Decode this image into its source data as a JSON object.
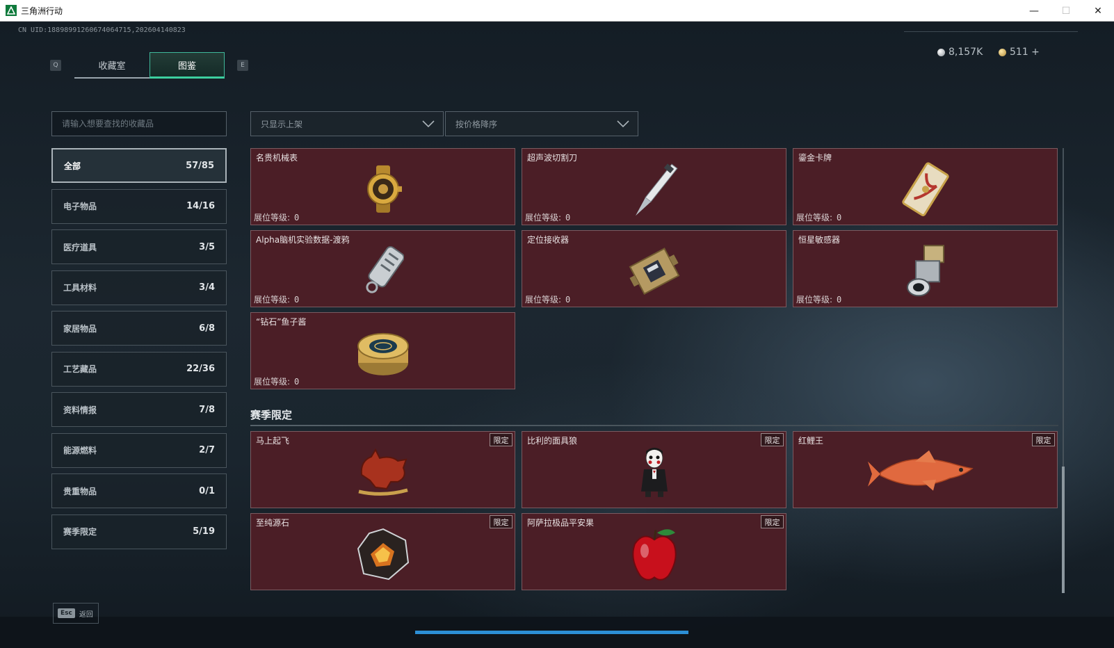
{
  "window": {
    "title": "三角洲行动",
    "minimize_glyph": "—",
    "maximize_glyph": "☐",
    "close_glyph": "✕"
  },
  "header": {
    "uid": "CN UID:18898991260674064715,202604140823",
    "key_prev": "Q",
    "key_next": "E",
    "tabs": [
      {
        "label": "收藏室",
        "active": false
      },
      {
        "label": "图鉴",
        "active": true
      }
    ],
    "currency": [
      {
        "type": "silver-coin-icon",
        "value": "8,157K"
      },
      {
        "type": "gold-coin-icon",
        "value": "511 +"
      }
    ]
  },
  "sidebar": {
    "search_placeholder": "请输入想要查找的收藏品",
    "categories": [
      {
        "label": "全部",
        "count": "57/85",
        "active": true
      },
      {
        "label": "电子物品",
        "count": "14/16"
      },
      {
        "label": "医疗道具",
        "count": "3/5"
      },
      {
        "label": "工具材料",
        "count": "3/4"
      },
      {
        "label": "家居物品",
        "count": "6/8"
      },
      {
        "label": "工艺藏品",
        "count": "22/36"
      },
      {
        "label": "资料情报",
        "count": "7/8"
      },
      {
        "label": "能源燃料",
        "count": "2/7"
      },
      {
        "label": "贵重物品",
        "count": "0/1"
      },
      {
        "label": "赛季限定",
        "count": "5/19"
      }
    ]
  },
  "filters": {
    "shelf_filter": "只显示上架",
    "sort": "按价格降序"
  },
  "items": [
    {
      "name": "名贵机械表",
      "level_label": "展位等级:",
      "level": "0",
      "icon": "watch-icon"
    },
    {
      "name": "超声波切割刀",
      "level_label": "展位等级:",
      "level": "0",
      "icon": "knife-icon"
    },
    {
      "name": "鎏金卡牌",
      "level_label": "展位等级:",
      "level": "0",
      "icon": "card-icon"
    },
    {
      "name": "Alpha脑机实验数据-渡鸦",
      "level_label": "展位等级:",
      "level": "0",
      "icon": "data-drive-icon"
    },
    {
      "name": "定位接收器",
      "level_label": "展位等级:",
      "level": "0",
      "icon": "receiver-icon"
    },
    {
      "name": "恒星敏感器",
      "level_label": "展位等级:",
      "level": "0",
      "icon": "sensor-icon"
    },
    {
      "name": "“钻石”鱼子酱",
      "level_label": "展位等级:",
      "level": "0",
      "icon": "caviar-icon"
    }
  ],
  "season_section": {
    "title": "赛季限定",
    "badge": "限定",
    "items": [
      {
        "name": "马上起飞",
        "icon": "horse-icon"
      },
      {
        "name": "比利的面具狼",
        "icon": "puppet-icon"
      },
      {
        "name": "红鲤王",
        "icon": "fish-icon"
      },
      {
        "name": "至纯源石",
        "icon": "crystal-icon"
      },
      {
        "name": "阿萨拉极品平安果",
        "icon": "apple-icon"
      }
    ]
  },
  "footer": {
    "esc_key": "Esc",
    "back_label": "返回"
  },
  "colors": {
    "card_bg": "#4b1e26",
    "accent": "#3ccf9f",
    "progress": "#2c8fd6"
  }
}
